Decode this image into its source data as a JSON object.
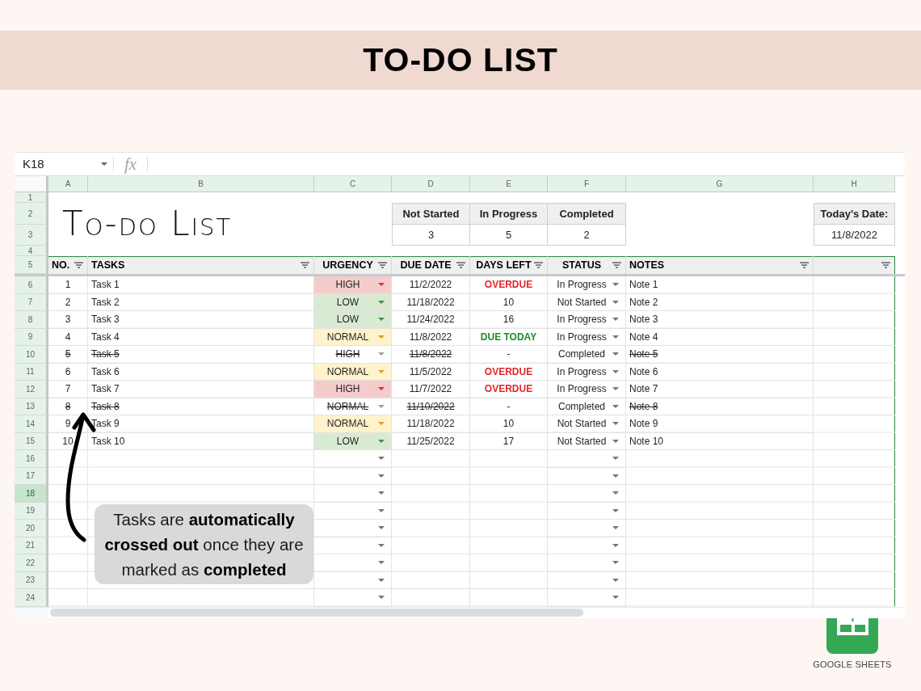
{
  "page_header": {
    "title": "TO-DO LIST"
  },
  "formula_bar": {
    "cell_reference": "K18",
    "function_label": "fx"
  },
  "spreadsheet": {
    "column_headers": [
      "A",
      "B",
      "C",
      "D",
      "E",
      "F",
      "G",
      "H"
    ],
    "row_headers": [
      {
        "label": "1",
        "selected": false
      },
      {
        "label": "2",
        "selected": false
      },
      {
        "label": "3",
        "selected": false
      },
      {
        "label": "4",
        "selected": false
      },
      {
        "label": "5",
        "selected": false
      },
      {
        "label": "6",
        "selected": false
      },
      {
        "label": "7",
        "selected": false
      },
      {
        "label": "8",
        "selected": false
      },
      {
        "label": "9",
        "selected": false
      },
      {
        "label": "10",
        "selected": false
      },
      {
        "label": "11",
        "selected": false
      },
      {
        "label": "12",
        "selected": false
      },
      {
        "label": "13",
        "selected": false
      },
      {
        "label": "14",
        "selected": false
      },
      {
        "label": "15",
        "selected": false
      },
      {
        "label": "16",
        "selected": false
      },
      {
        "label": "17",
        "selected": false
      },
      {
        "label": "18",
        "selected": true
      },
      {
        "label": "19",
        "selected": false
      },
      {
        "label": "20",
        "selected": false
      },
      {
        "label": "21",
        "selected": false
      },
      {
        "label": "22",
        "selected": false
      },
      {
        "label": "23",
        "selected": false
      },
      {
        "label": "24",
        "selected": false
      }
    ],
    "title": "To-do List",
    "summary": [
      {
        "label": "Not Started",
        "value": "3"
      },
      {
        "label": "In Progress",
        "value": "5"
      },
      {
        "label": "Completed",
        "value": "2"
      }
    ],
    "today": {
      "label": "Today's Date:",
      "value": "11/8/2022"
    },
    "table": {
      "columns": [
        {
          "label": "NO.",
          "filter": true
        },
        {
          "label": "TASKS",
          "filter": true
        },
        {
          "label": "URGENCY",
          "filter": true
        },
        {
          "label": "DUE DATE",
          "filter": true
        },
        {
          "label": "DAYS LEFT",
          "filter": true
        },
        {
          "label": "STATUS",
          "filter": true
        },
        {
          "label": "NOTES",
          "filter": true
        },
        {
          "filter": true
        }
      ],
      "rows": [
        {
          "kind": "task",
          "number": "1",
          "task": "Task 1",
          "urgency": {
            "label": "HIGH",
            "kind": "high"
          },
          "due_date": "11/2/2022",
          "days_left": {
            "label": "OVERDUE",
            "kind": "overdue"
          },
          "status": "In Progress",
          "notes": "Note 1",
          "completed": false
        },
        {
          "kind": "task",
          "number": "2",
          "task": "Task 2",
          "urgency": {
            "label": "LOW",
            "kind": "low"
          },
          "due_date": "11/18/2022",
          "days_left": {
            "label": "10",
            "kind": "days"
          },
          "status": "Not Started",
          "notes": "Note 2",
          "completed": false
        },
        {
          "kind": "task",
          "number": "3",
          "task": "Task 3",
          "urgency": {
            "label": "LOW",
            "kind": "low"
          },
          "due_date": "11/24/2022",
          "days_left": {
            "label": "16",
            "kind": "days"
          },
          "status": "In Progress",
          "notes": "Note 3",
          "completed": false
        },
        {
          "kind": "task",
          "number": "4",
          "task": "Task 4",
          "urgency": {
            "label": "NORMAL",
            "kind": "normal"
          },
          "due_date": "11/8/2022",
          "days_left": {
            "label": "DUE TODAY",
            "kind": "due_today"
          },
          "status": "In Progress",
          "notes": "Note 4",
          "completed": false
        },
        {
          "kind": "task",
          "number": "5",
          "task": "Task 5",
          "urgency": {
            "label": "HIGH",
            "kind": "high"
          },
          "due_date": "11/8/2022",
          "days_left": {
            "label": "-",
            "kind": "none"
          },
          "status": "Completed",
          "notes": "Note 5",
          "completed": true
        },
        {
          "kind": "task",
          "number": "6",
          "task": "Task 6",
          "urgency": {
            "label": "NORMAL",
            "kind": "normal"
          },
          "due_date": "11/5/2022",
          "days_left": {
            "label": "OVERDUE",
            "kind": "overdue"
          },
          "status": "In Progress",
          "notes": "Note 6",
          "completed": false
        },
        {
          "kind": "task",
          "number": "7",
          "task": "Task 7",
          "urgency": {
            "label": "HIGH",
            "kind": "high"
          },
          "due_date": "11/7/2022",
          "days_left": {
            "label": "OVERDUE",
            "kind": "overdue"
          },
          "status": "In Progress",
          "notes": "Note 7",
          "completed": false
        },
        {
          "kind": "task",
          "number": "8",
          "task": "Task 8",
          "urgency": {
            "label": "NORMAL",
            "kind": "normal"
          },
          "due_date": "11/10/2022",
          "days_left": {
            "label": "-",
            "kind": "none"
          },
          "status": "Completed",
          "notes": "Note 8",
          "completed": true
        },
        {
          "kind": "task",
          "number": "9",
          "task": "Task 9",
          "urgency": {
            "label": "NORMAL",
            "kind": "normal"
          },
          "due_date": "11/18/2022",
          "days_left": {
            "label": "10",
            "kind": "days"
          },
          "status": "Not Started",
          "notes": "Note 9",
          "completed": false
        },
        {
          "kind": "task",
          "number": "10",
          "task": "Task 10",
          "urgency": {
            "label": "LOW",
            "kind": "low"
          },
          "due_date": "11/25/2022",
          "days_left": {
            "label": "17",
            "kind": "days"
          },
          "status": "Not Started",
          "notes": "Note 10",
          "completed": false
        },
        {
          "kind": "blank"
        },
        {
          "kind": "blank"
        },
        {
          "kind": "blank"
        },
        {
          "kind": "blank"
        },
        {
          "kind": "blank"
        },
        {
          "kind": "blank"
        },
        {
          "kind": "blank"
        },
        {
          "kind": "blank"
        },
        {
          "kind": "blank"
        }
      ]
    }
  },
  "callout": {
    "lines": [
      "Tasks are **automatically**",
      "**crossed out** once they are",
      "marked as **completed**"
    ]
  },
  "app_badge": {
    "label": "GOOGLE SHEETS"
  }
}
